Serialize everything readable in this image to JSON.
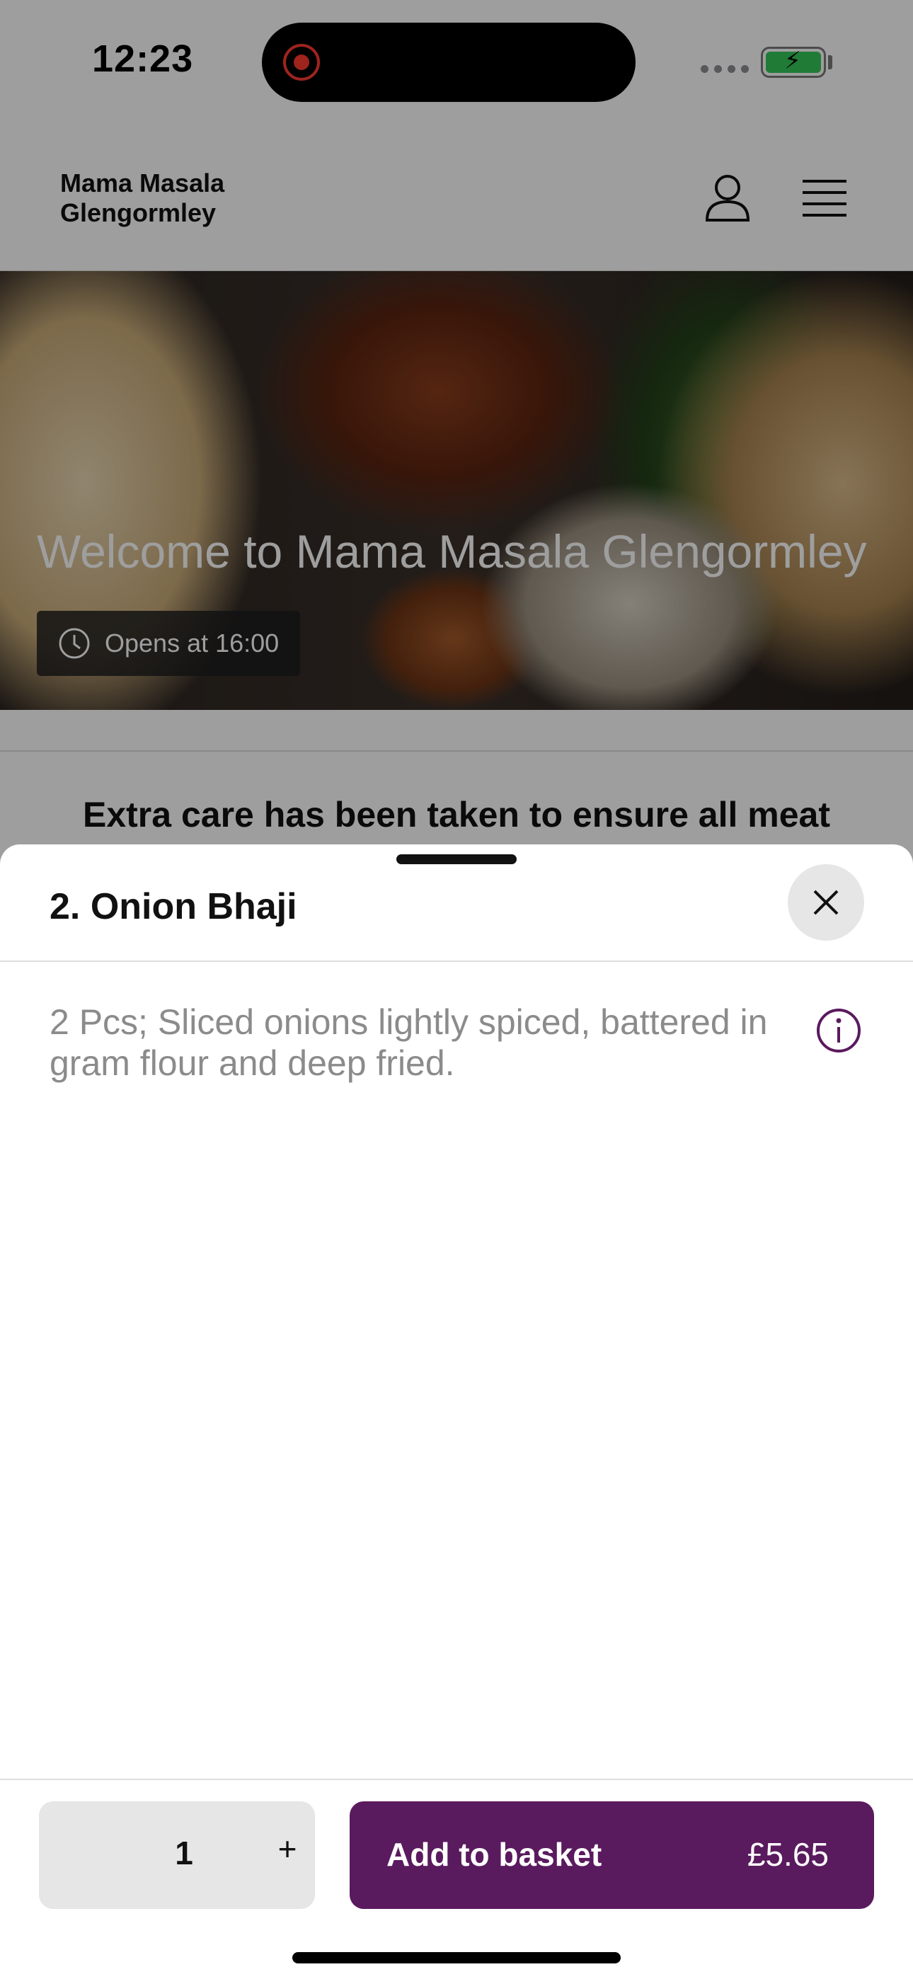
{
  "status_bar": {
    "time": "12:23",
    "battery_icon": "battery-charging-icon"
  },
  "header": {
    "brand": "Mama Masala\nGlengormley",
    "user_icon": "user-icon",
    "menu_icon": "menu-icon"
  },
  "hero": {
    "title": "Welcome to Mama Masala Glengormley",
    "badge": "Opens at 16:00"
  },
  "notice": {
    "text": "Extra care has been taken to ensure all meat"
  },
  "item_sheet": {
    "title": "2. Onion Bhaji",
    "description": "2 Pcs; Sliced onions lightly spiced, battered in gram flour and deep fried.",
    "quantity": "1",
    "plus_label": "+",
    "add_label": "Add to basket",
    "price": "£5.65"
  },
  "colors": {
    "accent": "#5a1a5e",
    "secondary_button": "#e6e6e6",
    "description_text": "#8b8b8b"
  }
}
